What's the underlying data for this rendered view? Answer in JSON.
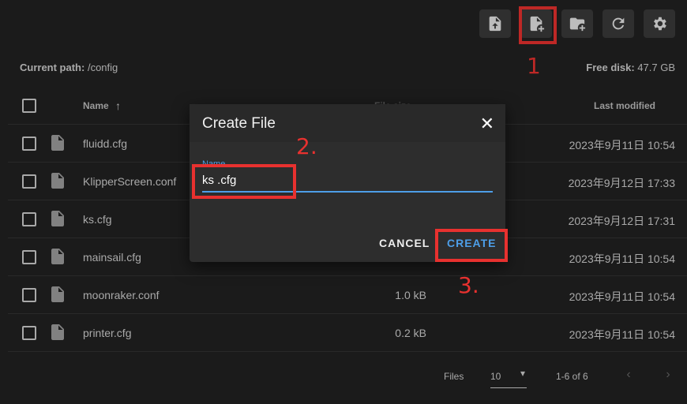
{
  "toolbar": {
    "buttons": [
      {
        "icon": "file-upload-icon"
      },
      {
        "icon": "file-add-icon"
      },
      {
        "icon": "folder-add-icon"
      },
      {
        "icon": "refresh-icon"
      },
      {
        "icon": "gear-icon"
      }
    ]
  },
  "path": {
    "label": "Current path:",
    "value": "/config",
    "disk_label": "Free disk:",
    "disk_value": "47.7 GB"
  },
  "table": {
    "headers": {
      "name": "Name",
      "size": "File size",
      "modified": "Last modified"
    },
    "rows": [
      {
        "name": "fluidd.cfg",
        "size": "",
        "modified": "2023年9月11日 10:54"
      },
      {
        "name": "KlipperScreen.conf",
        "size": "",
        "modified": "2023年9月12日 17:33"
      },
      {
        "name": "ks.cfg",
        "size": "",
        "modified": "2023年9月12日 17:31"
      },
      {
        "name": "mainsail.cfg",
        "size": "",
        "modified": "2023年9月11日 10:54"
      },
      {
        "name": "moonraker.conf",
        "size": "1.0 kB",
        "modified": "2023年9月11日 10:54"
      },
      {
        "name": "printer.cfg",
        "size": "0.2 kB",
        "modified": "2023年9月11日 10:54"
      }
    ]
  },
  "footer": {
    "rows_label": "Files",
    "rows_per_page": "10",
    "range": "1-6 of 6"
  },
  "dialog": {
    "title": "Create File",
    "field_label": "Name",
    "field_value": "ks .cfg",
    "cancel_label": "CANCEL",
    "create_label": "CREATE"
  },
  "annotations": {
    "a1": "1",
    "a2": "2.",
    "a3": "3.",
    "color": "#e8312f"
  },
  "colors": {
    "accent": "#4d9ee8",
    "background": "#212121"
  }
}
